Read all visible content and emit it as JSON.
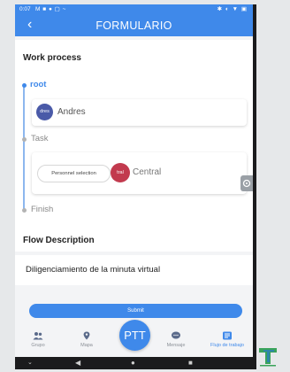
{
  "status_bar": {
    "time": "0:07",
    "left_icons": "M ■ ● ▢ ~",
    "right_icons": "✱ ◐ ▼ ▣"
  },
  "app_bar": {
    "back_icon": "back-arrow-icon",
    "title": "FORMULARIO"
  },
  "work_process": {
    "title": "Work process",
    "nodes": [
      {
        "label": "root",
        "label_color": "#3f89ea"
      },
      {
        "label": "Task",
        "label_color": "#888888"
      },
      {
        "label": "Finish",
        "label_color": "#888888"
      }
    ],
    "task_card_1": {
      "avatar_text": "dres",
      "avatar_color": "#4a5aa8",
      "name": "Andres"
    },
    "task_card_2": {
      "chip_label": "Personnel selection",
      "avatar_text": "tral",
      "avatar_color": "#c23a4e",
      "name": "Central"
    }
  },
  "flow_description": {
    "title": "Flow Description",
    "text": "Diligenciamiento de la minuta virtual"
  },
  "submit_button": {
    "label": "Submit"
  },
  "bottom_nav": {
    "items": [
      {
        "label": "Grupo",
        "icon": "group-icon"
      },
      {
        "label": "Mapa",
        "icon": "map-pin-icon"
      },
      {
        "label": "PTT",
        "icon": "ptt"
      },
      {
        "label": "Mensaje",
        "icon": "message-icon"
      },
      {
        "label": "Flujo de trabajo",
        "icon": "workflow-icon"
      }
    ]
  },
  "colors": {
    "primary": "#3f89ea",
    "background": "#f3f4f6"
  }
}
